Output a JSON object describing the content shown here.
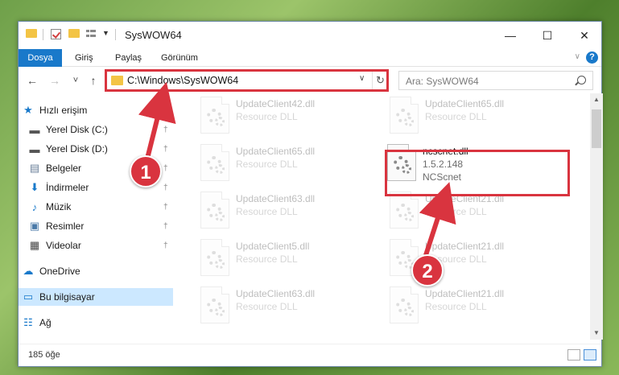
{
  "window": {
    "title": "SysWOW64",
    "controls": {
      "minimize": "—",
      "maximize": "☐",
      "close": "✕"
    }
  },
  "ribbon": {
    "tabs": [
      "Dosya",
      "Giriş",
      "Paylaş",
      "Görünüm"
    ],
    "help": "?"
  },
  "nav": {
    "back_icon": "←",
    "forward_icon": "→",
    "recent_icon": "˅",
    "up_icon": "↑",
    "address": "C:\\Windows\\SysWOW64",
    "address_dropdown_icon": "∨",
    "refresh_icon": "↻",
    "search_placeholder": "Ara: SysWOW64"
  },
  "sidebar": {
    "items": [
      {
        "label": "Hızlı erişim",
        "icon": "star-icon",
        "glyph": "★",
        "color": "#1979ca",
        "pinned": false
      },
      {
        "label": "Yerel Disk (C:)",
        "icon": "drive-icon",
        "glyph": "▬",
        "color": "#555555",
        "pinned": true
      },
      {
        "label": "Yerel Disk (D:)",
        "icon": "drive-icon",
        "glyph": "▬",
        "color": "#555555",
        "pinned": true
      },
      {
        "label": "Belgeler",
        "icon": "documents-icon",
        "glyph": "▤",
        "color": "#6a7f99",
        "pinned": true
      },
      {
        "label": "İndirmeler",
        "icon": "downloads-icon",
        "glyph": "⬇",
        "color": "#1979ca",
        "pinned": true
      },
      {
        "label": "Müzik",
        "icon": "music-icon",
        "glyph": "♪",
        "color": "#1979ca",
        "pinned": true
      },
      {
        "label": "Resimler",
        "icon": "pictures-icon",
        "glyph": "▣",
        "color": "#4a7aa8",
        "pinned": true
      },
      {
        "label": "Videolar",
        "icon": "videos-icon",
        "glyph": "▦",
        "color": "#444444",
        "pinned": true
      },
      {
        "label": "OneDrive",
        "icon": "cloud-icon",
        "glyph": "☁",
        "color": "#1979ca",
        "pinned": false
      },
      {
        "label": "Bu bilgisayar",
        "icon": "computer-icon",
        "glyph": "▭",
        "color": "#1979ca",
        "pinned": false,
        "selected": true
      },
      {
        "label": "Ağ",
        "icon": "network-icon",
        "glyph": "☷",
        "color": "#1979ca",
        "pinned": false
      }
    ],
    "pin_glyph": "📌"
  },
  "files": [
    {
      "name": "UpdateClient42.dll",
      "line2": "Resource DLL",
      "line3": ""
    },
    {
      "name": "UpdateClient65.dll",
      "line2": "Resource DLL",
      "line3": ""
    },
    {
      "name": "UpdateClient65.dll",
      "line2": "Resource DLL",
      "line3": ""
    },
    {
      "name": "ncscnet.dll",
      "line2": "1.5.2.148",
      "line3": "NCScnet",
      "highlighted": true
    },
    {
      "name": "UpdateClient63.dll",
      "line2": "Resource DLL",
      "line3": ""
    },
    {
      "name": "UpdateClient21.dll",
      "line2": "Resource DLL",
      "line3": ""
    },
    {
      "name": "UpdateClient5.dll",
      "line2": "Resource DLL",
      "line3": ""
    },
    {
      "name": "UpdateClient21.dll",
      "line2": "Resource DLL",
      "line3": ""
    },
    {
      "name": "UpdateClient63.dll",
      "line2": "Resource DLL",
      "line3": ""
    },
    {
      "name": "UpdateClient21.dll",
      "line2": "Resource DLL",
      "line3": ""
    }
  ],
  "status": {
    "item_count": "185 öğe"
  },
  "annotations": {
    "step1": "1",
    "step2": "2",
    "color": "#d9343f"
  }
}
